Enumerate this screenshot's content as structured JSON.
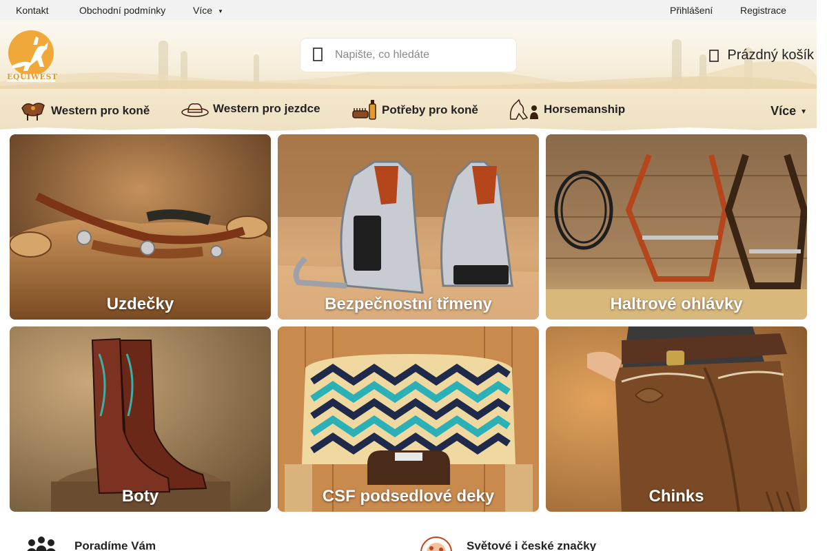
{
  "topbar": {
    "links": [
      "Kontakt",
      "Obchodní podmínky",
      "Více"
    ],
    "login": "Přihlášení",
    "register": "Registrace"
  },
  "header": {
    "logo_text": "EQUIWEST",
    "search_placeholder": "Napište, co hledáte",
    "cart_label": "Prázdný košík"
  },
  "nav": {
    "items": [
      "Western pro koně",
      "Western pro jezdce",
      "Potřeby pro koně",
      "Horsemanship"
    ],
    "more": "Více"
  },
  "tiles": [
    {
      "label": "Uzdečky",
      "icon": "bridle-photo"
    },
    {
      "label": "Bezpečnostní třmeny",
      "icon": "stirrups-photo"
    },
    {
      "label": "Haltrové ohlávky",
      "icon": "halters-photo"
    },
    {
      "label": "Boty",
      "icon": "boots-photo"
    },
    {
      "label": "CSF podsedlové deky",
      "icon": "saddle-pad-photo"
    },
    {
      "label": "Chinks",
      "icon": "chinks-photo"
    }
  ],
  "info": {
    "advice": "Poradíme Vám",
    "brands": "Světové i české značky"
  },
  "colors": {
    "header_bg": "#f7f0df",
    "nav_bg": "#f1e4c7",
    "topbar_bg": "#f2f2f2",
    "logo_orange": "#e59a2b"
  }
}
